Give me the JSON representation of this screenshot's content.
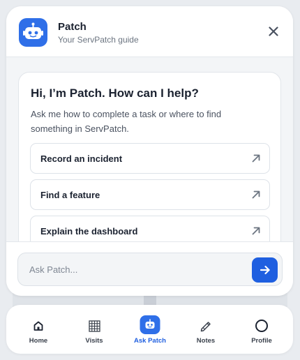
{
  "header": {
    "title": "Patch",
    "subtitle": "Your ServPatch guide",
    "avatar_icon": "robot-icon",
    "close_icon": "close-icon"
  },
  "intro": {
    "title": "Hi, I’m Patch. How can I help?",
    "description": "Ask me how to complete a task or where to find something in ServPatch."
  },
  "suggestions": [
    {
      "label": "Record an incident",
      "icon": "arrow-up-right-icon"
    },
    {
      "label": "Find a feature",
      "icon": "arrow-up-right-icon"
    },
    {
      "label": "Explain the dashboard",
      "icon": "arrow-up-right-icon"
    }
  ],
  "composer": {
    "placeholder": "Ask Patch...",
    "value": "",
    "send_icon": "arrow-right-icon"
  },
  "tabs": [
    {
      "label": "Home",
      "icon": "home-icon",
      "active": false
    },
    {
      "label": "Visits",
      "icon": "grid-icon",
      "active": false
    },
    {
      "label": "Ask Patch",
      "icon": "robot-icon",
      "active": true
    },
    {
      "label": "Notes",
      "icon": "pencil-icon",
      "active": false
    },
    {
      "label": "Profile",
      "icon": "profile-circle-icon",
      "active": false
    }
  ],
  "colors": {
    "accent": "#1f5fe0",
    "avatar": "#2f6fe8",
    "background": "#e9ecf0",
    "content_background": "#f3f5f7"
  }
}
